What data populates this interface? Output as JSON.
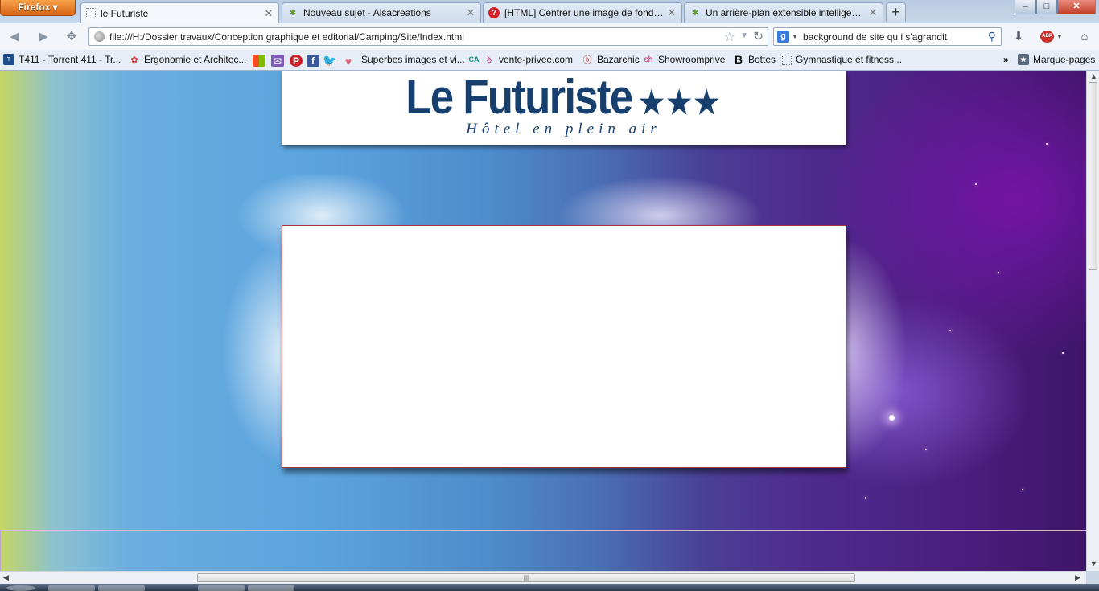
{
  "browser": {
    "menu_button": "Firefox ▾",
    "tabs": [
      {
        "title": "le Futuriste",
        "active": true,
        "icon": "blank-page-icon"
      },
      {
        "title": "Nouveau sujet - Alsacreations",
        "active": false,
        "icon": "alsacreations-icon"
      },
      {
        "title": "[HTML] Centrer une image de fond d...",
        "active": false,
        "icon": "help-icon"
      },
      {
        "title": "Un arrière-plan extensible intelligent -...",
        "active": false,
        "icon": "alsacreations-icon"
      }
    ],
    "new_tab": "+",
    "window_buttons": {
      "minimize": "–",
      "maximize": "□",
      "close": "✕"
    },
    "url": "file:///H:/Dossier travaux/Conception graphique et editorial/Camping/Site/Index.html",
    "search_engine": "g",
    "search_value": "background de site qu i s'agrandit",
    "addon_badge": "ABP"
  },
  "bookmarks": {
    "items": [
      {
        "label": "T411 - Torrent 411 - Tr...",
        "icon": "t411-icon"
      },
      {
        "label": "Ergonomie et Architec...",
        "icon": "flower-icon"
      },
      {
        "label": "Superbes images et vi...",
        "icon": "heart-icon"
      },
      {
        "label": "vente-privee.com",
        "icon": "credit-agricole-icon"
      },
      {
        "label": "Bazarchic",
        "icon": "bazarchic-icon"
      },
      {
        "label": "Showroomprive",
        "icon": "showroomprive-icon"
      },
      {
        "label": "Bottes",
        "icon": "bottes-icon"
      },
      {
        "label": "Gymnastique et fitness...",
        "icon": "blank-page-icon"
      }
    ],
    "overflow": "»",
    "bookmarks_menu": "Marque-pages"
  },
  "page": {
    "title": "Le Futuriste",
    "rating": "★★★",
    "subtitle": "Hôtel en plein air"
  },
  "colors": {
    "title_blue": "#17406e",
    "main_box_border": "#a33a3a"
  }
}
